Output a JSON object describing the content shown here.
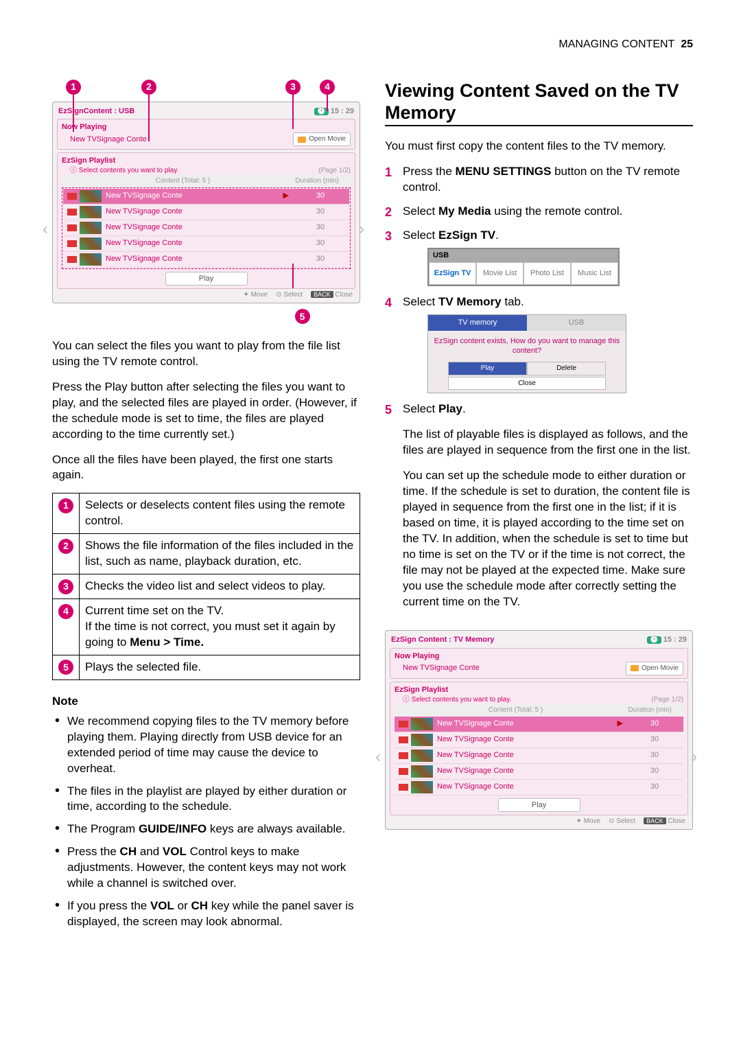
{
  "header": {
    "section": "MANAGING CONTENT",
    "page": "25"
  },
  "ui1": {
    "title_prefix": "EzSign",
    "title_mid": "Content : ",
    "title_suffix": "USB",
    "clock": "15 : 29",
    "now_playing_label": "Now Playing",
    "now_playing_content": "New TVSignage Conte",
    "open_movie": "Open Movie",
    "playlist_label": "EzSign Playlist",
    "hint": "Select contents you want to play.",
    "page_info": "(Page 1/2)",
    "col_content": "Content (Total: 5 )",
    "col_duration": "Duration (min)",
    "rows": [
      {
        "name": "New TVSignage Conte",
        "dur": "30",
        "playing": true
      },
      {
        "name": "New TVSignage Conte",
        "dur": "30",
        "playing": false
      },
      {
        "name": "New TVSignage Conte",
        "dur": "30",
        "playing": false
      },
      {
        "name": "New TVSignage Conte",
        "dur": "30",
        "playing": false
      },
      {
        "name": "New TVSignage Conte",
        "dur": "30",
        "playing": false
      }
    ],
    "play_btn": "Play",
    "footer_move": "Move",
    "footer_select": "Select",
    "footer_back": "BACK",
    "footer_close": "Close"
  },
  "callouts": {
    "c1": "1",
    "c2": "2",
    "c3": "3",
    "c4": "4",
    "c5": "5"
  },
  "left": {
    "p1": "You can select the files you want to play from the file list using the TV remote control.",
    "p2": "Press the Play button after selecting the files you want to play, and the selected files are played in order. (However, if the schedule mode is set to time, the files are played according to the time currently set.)",
    "p3": "Once all the files have been played, the first one starts again.",
    "legend": {
      "r1": "Selects or deselects content files using the remote control.",
      "r2": "Shows the file information of the files included in the list, such as name, playback duration, etc.",
      "r3": "Checks the video list and select videos to play.",
      "r4a": "Current time set on the TV.",
      "r4b": "If the time is not correct, you must set it again by going to ",
      "r4c": "Menu > Time.",
      "r5": "Plays the selected file."
    },
    "note_h": "Note",
    "notes": {
      "n1": "We recommend copying files to the TV memory before playing them. Playing directly from USB device for an extended period of time may cause the device to overheat.",
      "n2": "The files in the playlist are played by either duration or time, according to the schedule.",
      "n3a": "The Program ",
      "n3b": "GUIDE/INFO",
      "n3c": " keys are always available.",
      "n4a": "Press the ",
      "n4b": "CH",
      "n4c": " and ",
      "n4d": "VOL",
      "n4e": " Control keys to make adjustments. However, the content keys may not work while a channel is switched over.",
      "n5a": "If you press the ",
      "n5b": "VOL",
      "n5c": " or ",
      "n5d": "CH",
      "n5e": " key while the panel saver is displayed, the screen may look abnormal."
    }
  },
  "right": {
    "h2": "Viewing Content Saved on the TV Memory",
    "intro": "You must first copy the content files to the TV memory.",
    "s1a": "Press the ",
    "s1b": "MENU SETTINGS",
    "s1c": " button on the TV remote control.",
    "s2a": "Select ",
    "s2b": "My Media",
    "s2c": " using the remote control.",
    "s3a": "Select ",
    "s3b": "EzSign TV",
    "s3c": ".",
    "media": {
      "hdr": "USB",
      "t1": "EzSign TV",
      "t2": "Movie List",
      "t3": "Photo List",
      "t4": "Music List"
    },
    "s4a": "Select ",
    "s4b": "TV Memory",
    "s4c": " tab.",
    "tvmem": {
      "tab1": "TV memory",
      "tab2": "USB",
      "msg": "EzSign content exists, How do you want to manage this content?",
      "play": "Play",
      "delete": "Delete",
      "close": "Close"
    },
    "s5a": "Select ",
    "s5b": "Play",
    "s5c": ".",
    "p_after5": "The list of playable files is displayed as follows, and the files are played in sequence from the first one in the list.",
    "p_long": "You can set up the schedule mode to either duration or time. If the schedule is set to duration, the content file is played in sequence from the first one in the list; if it is based on time, it is played according to the time set on the TV. In addition, when the schedule is set to time but no time is set on the TV or if the time is not correct, the file may not be played at the expected time. Make sure you use the schedule mode after correctly setting the current time on the TV."
  },
  "ui2": {
    "title": "EzSign Content : TV Memory",
    "clock": "15 : 29"
  }
}
